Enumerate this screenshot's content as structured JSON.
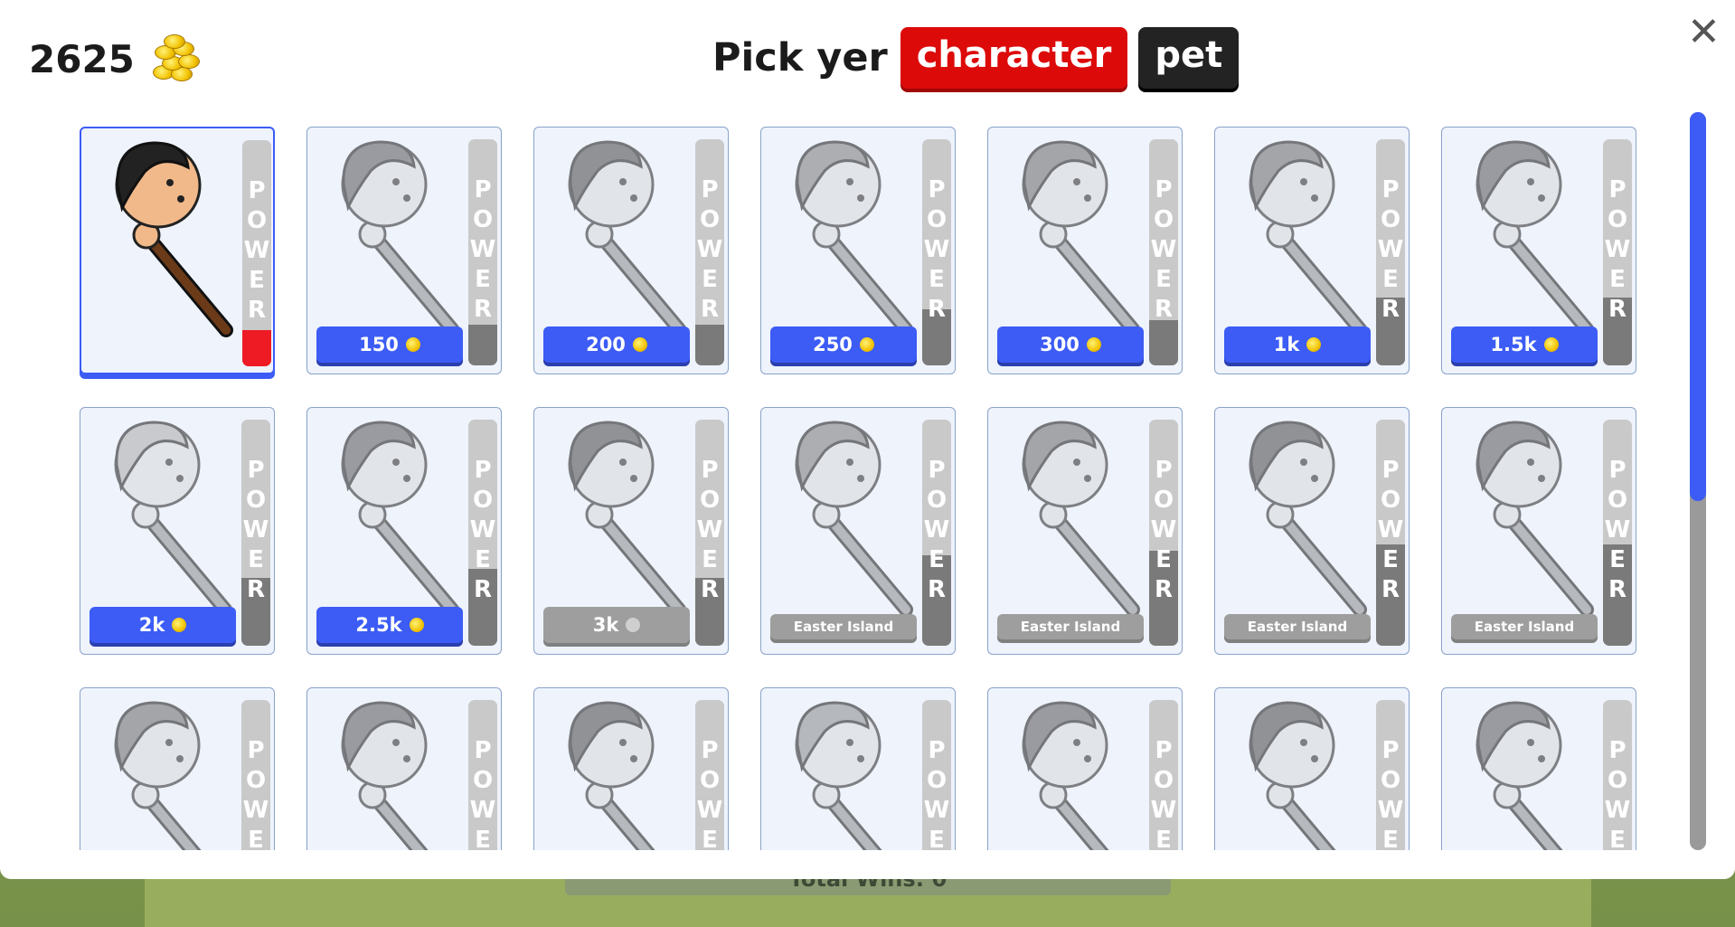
{
  "header": {
    "coins": "2625",
    "title": "Pick yer",
    "tabs": [
      {
        "label": "character",
        "active": true
      },
      {
        "label": "pet",
        "active": false
      }
    ],
    "close": "✕"
  },
  "background": {
    "wins_text": "Total Wins: 0"
  },
  "power_text": "P\nO\nW\nE\nR",
  "colors": {
    "accent": "#3c5cf5",
    "active_tab": "#dd0a0a",
    "power_fill": "#ee1b24"
  },
  "characters": [
    {
      "name": "pirate-warrior",
      "price": "",
      "state": "selected"
    },
    {
      "name": "warrior-bandana",
      "price": "150",
      "state": "buy"
    },
    {
      "name": "warrior-helmet",
      "price": "200",
      "state": "buy"
    },
    {
      "name": "warrior-diver",
      "price": "250",
      "state": "buy"
    },
    {
      "name": "warrior-skeleton",
      "price": "300",
      "state": "buy"
    },
    {
      "name": "warrior-ninja",
      "price": "1k",
      "state": "buy"
    },
    {
      "name": "warrior-kraken",
      "price": "1.5k",
      "state": "buy"
    },
    {
      "name": "warrior-cloud",
      "price": "2k",
      "state": "buy"
    },
    {
      "name": "warrior-cyclops",
      "price": "2.5k",
      "state": "buy"
    },
    {
      "name": "warrior-captain",
      "price": "3k",
      "state": "locked"
    },
    {
      "name": "warrior-chain",
      "price": "Easter Island",
      "state": "event"
    },
    {
      "name": "warrior-shark",
      "price": "Easter Island",
      "state": "event"
    },
    {
      "name": "warrior-vines",
      "price": "Easter Island",
      "state": "event"
    },
    {
      "name": "warrior-seaweed",
      "price": "Easter Island",
      "state": "event"
    },
    {
      "name": "warrior-fish",
      "price": "",
      "state": "dim"
    },
    {
      "name": "warrior-frog",
      "price": "",
      "state": "dim"
    },
    {
      "name": "warrior-trident",
      "price": "",
      "state": "dim"
    },
    {
      "name": "warrior-bubbles",
      "price": "",
      "state": "dim"
    },
    {
      "name": "warrior-crab",
      "price": "",
      "state": "dim"
    },
    {
      "name": "warrior-tribal",
      "price": "",
      "state": "dim"
    },
    {
      "name": "warrior-clown",
      "price": "",
      "state": "dim"
    }
  ]
}
